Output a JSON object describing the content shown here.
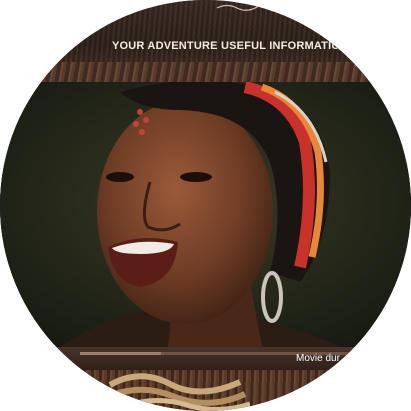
{
  "nav": {
    "items": [
      {
        "label": "ION"
      },
      {
        "label": "YOUR ADVENTURE"
      },
      {
        "label": "USEFUL INFORMATION"
      }
    ]
  },
  "video": {
    "caption": "Movie dur",
    "progress_fraction": 0.27
  },
  "colors": {
    "nav_text": "#f4ede4",
    "wood_dark": "#2e211b",
    "headwrap_red": "#c8322a",
    "headwrap_orange": "#e7873a"
  }
}
